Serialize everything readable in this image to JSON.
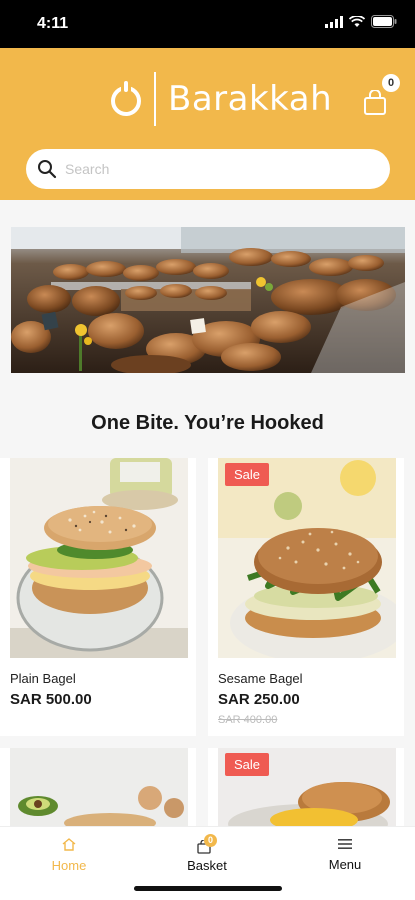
{
  "status_bar": {
    "time": "4:11"
  },
  "header": {
    "brand": "Barakkah",
    "basket_count": "0",
    "search_placeholder": "Search"
  },
  "section": {
    "title": "One Bite. You’re Hooked"
  },
  "products": [
    {
      "name": "Plain Bagel",
      "price": "SAR 500.00",
      "old_price": "",
      "sale": ""
    },
    {
      "name": "Sesame Bagel",
      "price": "SAR 250.00",
      "old_price": "SAR 400.00",
      "sale": "Sale"
    },
    {
      "name": "",
      "price": "",
      "old_price": "",
      "sale": ""
    },
    {
      "name": "",
      "price": "",
      "old_price": "",
      "sale": "Sale"
    }
  ],
  "nav": {
    "home": "Home",
    "basket": "Basket",
    "basket_count": "0",
    "menu": "Menu"
  },
  "colors": {
    "brand_yellow": "#f2b84b",
    "sale_red": "#ef5b52",
    "active_nav": "#f2b84b"
  },
  "icons": [
    "signal-icon",
    "wifi-icon",
    "battery-icon",
    "shopping-bag-icon",
    "search-icon",
    "home-icon",
    "basket-icon",
    "menu-icon"
  ]
}
